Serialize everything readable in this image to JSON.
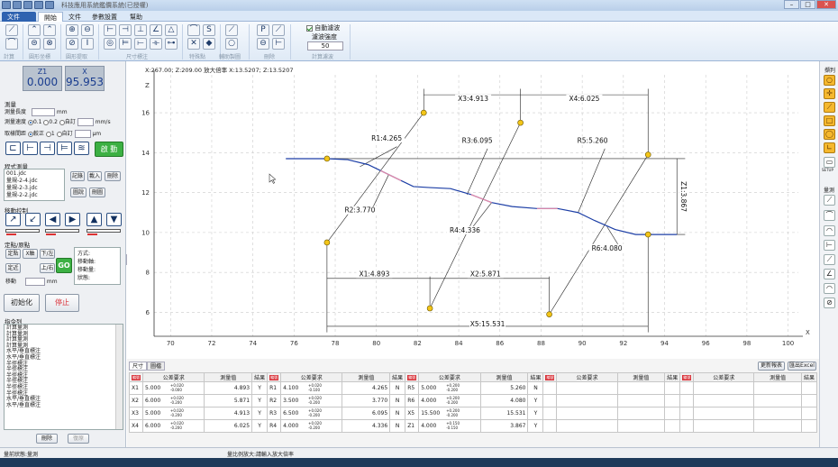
{
  "titlebar": {
    "title": "科技應用系統鑑價系統(已授權)"
  },
  "tabs": {
    "file": "文件",
    "items": [
      "開始",
      "文件",
      "參數設置",
      "幫助"
    ]
  },
  "ribbon": {
    "groups": [
      "計算",
      "圓形坐標",
      "圓形提取",
      "尺寸標注",
      "特殊點",
      "輔助製圖",
      "刪除",
      "計算濾波"
    ],
    "filter": {
      "checkbox_label": "自動濾波",
      "strength_label": "濾波強度",
      "strength_value": "50"
    }
  },
  "axes_display": {
    "z1_label": "Z1",
    "z1_value": "0.000",
    "x_label": "X",
    "x_value": "95.953"
  },
  "measure": {
    "section": "測量",
    "height_label": "測量長度",
    "height_unit": "mm",
    "speed_label": "測量速度",
    "speed_options": [
      "0.1",
      "0.2",
      "自訂"
    ],
    "speed_unit": "mm/s",
    "spacing_label": "取樣間距",
    "spacing_options": [
      "較正",
      "1",
      "自訂"
    ],
    "spacing_unit": "μm",
    "start_button": "啟 動"
  },
  "program": {
    "section": "程式測量",
    "files": [
      "001.jdc",
      "量規-2-4.jdc",
      "量規-2-3.jdc",
      "量規-2-2.jdc"
    ],
    "buttons": [
      "記錄",
      "載入",
      "刪除",
      "圖說",
      "刪圖"
    ]
  },
  "move": {
    "section": "移動控制"
  },
  "position": {
    "section": "定點/原點",
    "row1": [
      "定點",
      "X軸",
      "下/左"
    ],
    "row2": [
      "定近",
      "上/右"
    ],
    "move_label": "移動",
    "move_unit": "mm",
    "go": "GO",
    "info_labels": [
      "方式:",
      "移動軸:",
      "移動量:",
      "狀態:"
    ]
  },
  "actions": {
    "init": "初始化",
    "stop": "停止"
  },
  "commands": {
    "section": "指令列",
    "items": [
      "計算量測",
      "計算量測",
      "計算量測",
      "計算量測",
      "水平/垂直標注",
      "水平/垂直標注",
      "半徑標注",
      "半徑標注",
      "半徑標注",
      "半徑標注",
      "半徑標注",
      "半徑標注",
      "水平/垂直標注",
      "水平/垂直標注"
    ],
    "delete": "刪除",
    "restore": "復原"
  },
  "status": {
    "left": "量前狀態:量測",
    "center": "量比例放大:請輸入放大倍率"
  },
  "canvas": {
    "coord_readout": "X:267.00; Z:209.00   放大倍率 X:13.5207; Z:13.5207",
    "x_axis_label": "X",
    "z_axis_label": "Z"
  },
  "chart_data": {
    "type": "line",
    "x_ticks": [
      70,
      72,
      74,
      76,
      78,
      80,
      82,
      84,
      86,
      88,
      90,
      92,
      94,
      96,
      98,
      100
    ],
    "z_ticks": [
      6,
      8,
      10,
      12,
      14,
      16
    ],
    "xlim": [
      69.2,
      100.5
    ],
    "ylim": [
      4.8,
      17.9
    ],
    "grid": true,
    "profile": [
      [
        75.6,
        13.7
      ],
      [
        77.6,
        13.7
      ],
      [
        78.6,
        13.65
      ],
      [
        79.6,
        13.4
      ],
      [
        80.4,
        13.0
      ],
      [
        81.2,
        12.6
      ],
      [
        81.8,
        12.3
      ],
      [
        82.6,
        12.25
      ],
      [
        83.6,
        12.2
      ],
      [
        84.6,
        11.9
      ],
      [
        85.6,
        11.5
      ],
      [
        86.6,
        11.3
      ],
      [
        87.8,
        11.2
      ],
      [
        88.8,
        11.2
      ],
      [
        89.8,
        11.0
      ],
      [
        90.6,
        10.6
      ],
      [
        91.6,
        10.15
      ],
      [
        92.6,
        9.9
      ],
      [
        93.6,
        9.9
      ],
      [
        94.6,
        9.9
      ]
    ],
    "key_points": [
      [
        77.6,
        13.7
      ],
      [
        77.6,
        9.5
      ],
      [
        82.3,
        16.0
      ],
      [
        82.6,
        6.2
      ],
      [
        87.0,
        15.5
      ],
      [
        88.4,
        5.9
      ],
      [
        93.2,
        13.9
      ],
      [
        93.2,
        9.9
      ]
    ],
    "annotations": [
      {
        "text": "R1:4.265",
        "at": [
          80.5,
          14.6
        ]
      },
      {
        "text": "R2:3.770",
        "at": [
          79.2,
          11.0
        ]
      },
      {
        "text": "R3:6.095",
        "at": [
          84.9,
          14.5
        ]
      },
      {
        "text": "R4:4.336",
        "at": [
          84.3,
          10.0
        ]
      },
      {
        "text": "R5:5.260",
        "at": [
          90.5,
          14.5
        ]
      },
      {
        "text": "R6:4.080",
        "at": [
          91.2,
          9.1
        ]
      },
      {
        "text": "X3:4.913",
        "at": [
          84.7,
          16.6
        ]
      },
      {
        "text": "X4:6.025",
        "at": [
          90.1,
          16.6
        ]
      },
      {
        "text": "X1:4.893",
        "at": [
          79.9,
          7.8
        ]
      },
      {
        "text": "X2:5.871",
        "at": [
          85.3,
          7.8
        ]
      },
      {
        "text": "X5:15.531",
        "at": [
          85.4,
          5.3
        ]
      },
      {
        "text": "Z1:3.867",
        "at": [
          94.8,
          11.8
        ]
      }
    ]
  },
  "results_toolbar": {
    "tabs": [
      "尺寸",
      "圖檔"
    ],
    "buttons": [
      "更新報表",
      "匯出Excel"
    ]
  },
  "results": {
    "headers": [
      "編號",
      "公差要求",
      "測量值",
      "結果"
    ],
    "tag": "編號",
    "groups": [
      [
        {
          "id": "X1",
          "nominal": "5.000",
          "tol_plus": "+0.020",
          "tol_minus": "-0.000",
          "measured": "4.893",
          "result": "Y"
        },
        {
          "id": "X2",
          "nominal": "6.000",
          "tol_plus": "+0.020",
          "tol_minus": "-0.200",
          "measured": "5.871",
          "result": "Y"
        },
        {
          "id": "X3",
          "nominal": "5.000",
          "tol_plus": "+0.020",
          "tol_minus": "-0.200",
          "measured": "4.913",
          "result": "Y"
        },
        {
          "id": "X4",
          "nominal": "6.000",
          "tol_plus": "+0.020",
          "tol_minus": "-0.200",
          "measured": "6.025",
          "result": "Y"
        }
      ],
      [
        {
          "id": "R1",
          "nominal": "4.100",
          "tol_plus": "+0.020",
          "tol_minus": "-0.100",
          "measured": "4.265",
          "result": "N"
        },
        {
          "id": "R2",
          "nominal": "3.500",
          "tol_plus": "+0.020",
          "tol_minus": "-0.200",
          "measured": "3.770",
          "result": "N"
        },
        {
          "id": "R3",
          "nominal": "6.500",
          "tol_plus": "+0.020",
          "tol_minus": "-0.200",
          "measured": "6.095",
          "result": "N"
        },
        {
          "id": "R4",
          "nominal": "4.000",
          "tol_plus": "+0.020",
          "tol_minus": "-0.200",
          "measured": "4.336",
          "result": "N"
        }
      ],
      [
        {
          "id": "R5",
          "nominal": "5.000",
          "tol_plus": "+0.200",
          "tol_minus": "-0.200",
          "measured": "5.260",
          "result": "N"
        },
        {
          "id": "R6",
          "nominal": "4.000",
          "tol_plus": "+0.200",
          "tol_minus": "-0.200",
          "measured": "4.080",
          "result": "Y"
        },
        {
          "id": "X5",
          "nominal": "15.500",
          "tol_plus": "+0.200",
          "tol_minus": "-0.200",
          "measured": "15.531",
          "result": "Y"
        },
        {
          "id": "Z1",
          "nominal": "4.000",
          "tol_plus": "+0.150",
          "tol_minus": "-0.150",
          "measured": "3.867",
          "result": "Y"
        }
      ]
    ]
  },
  "right_tools": {
    "label_top": "擷判",
    "label_mid": "量測",
    "setup": "SETUP"
  },
  "colors": {
    "accent": "#2f63b0",
    "green": "#3cb043",
    "red": "#d9333a",
    "profile": "#1d3fa6",
    "marker": "#f3c518"
  }
}
